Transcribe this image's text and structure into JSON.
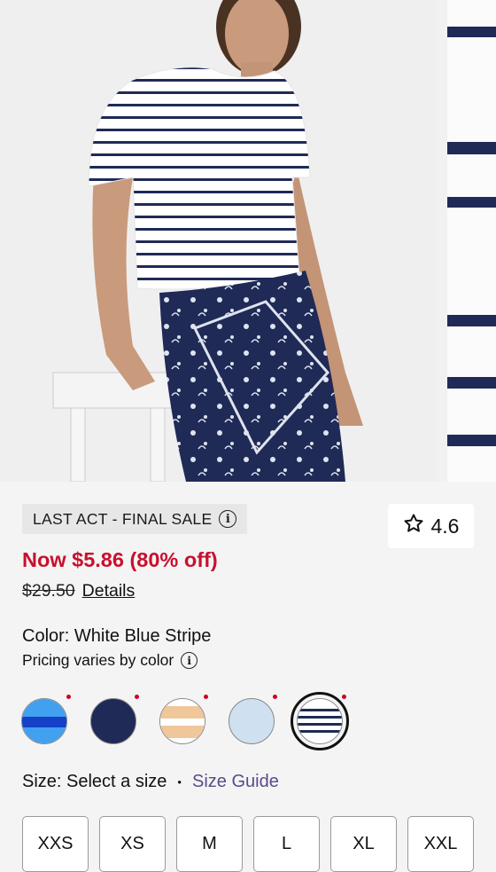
{
  "badge": {
    "label": "LAST ACT - FINAL SALE"
  },
  "rating": {
    "value": "4.6"
  },
  "price": {
    "sale": "Now $5.86 (80% off)",
    "original": "$29.50",
    "details_link": "Details"
  },
  "color": {
    "label": "Color: White Blue Stripe",
    "pricing_note": "Pricing varies by color"
  },
  "swatches": [
    {
      "name": "Bright Blue Stripe"
    },
    {
      "name": "Navy"
    },
    {
      "name": "Tan Stripe"
    },
    {
      "name": "Light Blue"
    },
    {
      "name": "White Blue Stripe",
      "selected": true
    }
  ],
  "size": {
    "label": "Size: Select a size",
    "separator": "•",
    "guide_link": "Size Guide",
    "options": [
      "XXS",
      "XS",
      "M",
      "L",
      "XL",
      "XXL"
    ]
  },
  "colors": {
    "sale_red": "#c8102e",
    "navy": "#1f2a56",
    "link_purple": "#5b4a8a"
  }
}
